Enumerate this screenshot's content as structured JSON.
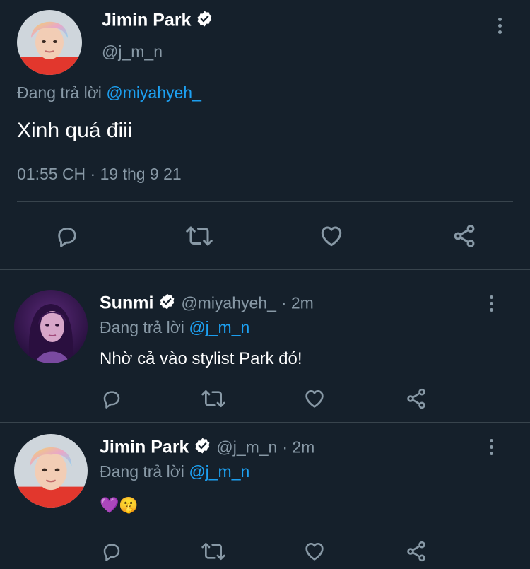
{
  "main_tweet": {
    "author_name": "Jimin Park",
    "author_handle": "@j_m_n",
    "replying_prefix": "Đang trả lời",
    "replying_to": "@miyahyeh_",
    "text": "Xinh quá điii",
    "timestamp": "01:55 CH · 19 thg 9 21"
  },
  "replies": [
    {
      "author_name": "Sunmi",
      "author_handle": "@miyahyeh_",
      "time": "· 2m",
      "replying_prefix": "Đang trả lời",
      "replying_to": "@j_m_n",
      "text": "Nhờ cả vào stylist Park đó!"
    },
    {
      "author_name": "Jimin Park",
      "author_handle": "@j_m_n",
      "time": "· 2m",
      "replying_prefix": "Đang trả lời",
      "replying_to": "@j_m_n",
      "text": "💜🤫"
    }
  ],
  "colors": {
    "background": "#15202b",
    "muted": "#8899a6",
    "link": "#1da1f2",
    "divider": "#38444d"
  },
  "icons": [
    "reply-icon",
    "retweet-icon",
    "like-icon",
    "share-icon",
    "verified-badge-icon",
    "more-options-icon"
  ]
}
